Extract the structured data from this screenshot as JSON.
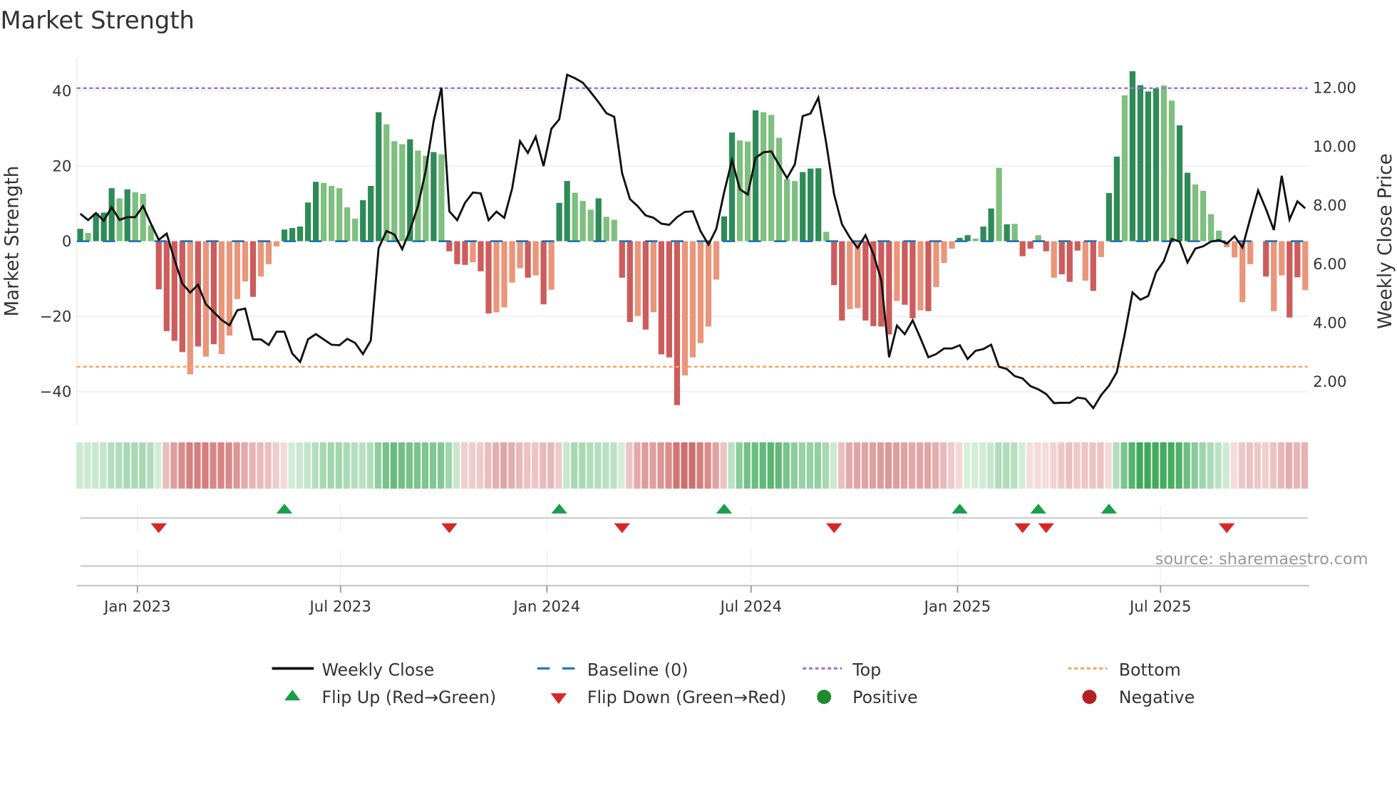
{
  "chart_data": {
    "type": "bar+line",
    "title": "Market Strength",
    "ylabel_left": "Market Strength",
    "ylabel_right": "Weekly Close Price",
    "ylim_left": [
      -49,
      49
    ],
    "ylim_right": [
      0.6,
      13.8
    ],
    "yticks_left": [
      40,
      20,
      0,
      -20,
      -40
    ],
    "ytick_labels_left": [
      "40",
      "20",
      "0",
      "−20",
      "−40"
    ],
    "yticks_right": [
      12,
      10,
      8,
      6,
      4,
      2
    ],
    "ytick_labels_right": [
      "12.00",
      "10.00",
      "8.00",
      "6.00",
      "4.00",
      "2.00"
    ],
    "x_start": "2022-11-11",
    "x_step_days": 7,
    "xticks": [
      {
        "date": "2023-01-01",
        "label": "Jan 2023"
      },
      {
        "date": "2023-07-01",
        "label": "Jul 2023"
      },
      {
        "date": "2024-01-01",
        "label": "Jan 2024"
      },
      {
        "date": "2024-07-01",
        "label": "Jul 2024"
      },
      {
        "date": "2025-01-01",
        "label": "Jan 2025"
      },
      {
        "date": "2025-07-01",
        "label": "Jul 2025"
      }
    ],
    "top_level": 40.7,
    "bottom_level": -33.4,
    "baseline": 0,
    "strength": [
      3.3,
      2.2,
      7.4,
      7.6,
      14.1,
      11.4,
      13.8,
      13.0,
      12.6,
      4.2,
      -12.8,
      -23.9,
      -26.5,
      -29.5,
      -35.4,
      -28.0,
      -30.7,
      -27.4,
      -30.0,
      -25.1,
      -15.4,
      -10.7,
      -14.8,
      -9.4,
      -6.1,
      -1.4,
      3.1,
      3.5,
      3.9,
      10.3,
      15.8,
      15.5,
      14.7,
      14.1,
      9.0,
      6.0,
      10.9,
      14.7,
      34.3,
      31.1,
      26.6,
      25.8,
      27.1,
      24.1,
      22.7,
      23.7,
      23.1,
      -2.7,
      -6.1,
      -6.3,
      -5.6,
      -8.0,
      -19.2,
      -18.9,
      -17.6,
      -11.0,
      -7.2,
      -9.7,
      -9.1,
      -16.8,
      -12.9,
      10.2,
      16.0,
      12.9,
      10.7,
      8.4,
      11.4,
      6.5,
      5.7,
      -9.7,
      -21.5,
      -19.9,
      -23.5,
      -18.9,
      -30.1,
      -30.9,
      -43.6,
      -35.7,
      -30.9,
      -27.1,
      -22.7,
      -10.2,
      6.6,
      28.9,
      26.8,
      26.5,
      34.8,
      34.3,
      33.6,
      27.5,
      16.5,
      16.0,
      18.4,
      19.3,
      19.4,
      2.5,
      -11.7,
      -21.1,
      -18.1,
      -17.8,
      -21.1,
      -22.6,
      -22.7,
      -24.8,
      -15.9,
      -16.9,
      -20.5,
      -18.4,
      -18.6,
      -12.2,
      -5.8,
      -2.0,
      0.9,
      1.6,
      0.7,
      3.9,
      8.7,
      19.5,
      4.5,
      4.6,
      -4.0,
      -2.0,
      1.6,
      -2.7,
      -9.7,
      -8.8,
      -10.8,
      -2.5,
      -10.5,
      -13.2,
      -4.2,
      12.8,
      22.5,
      38.8,
      45.2,
      41.5,
      39.8,
      40.7,
      41.4,
      37.4,
      30.8,
      18.2,
      15.1,
      13.4,
      7.2,
      2.8,
      -1.6,
      -4.3,
      -16.2,
      -6.1,
      0,
      -9.4,
      -18.6,
      -9.1,
      -20.3,
      -9.6,
      -13.0
    ],
    "strength_shade": "dldddldlllddddldldlllldllldddddllllldddllldlldlddd lddlllldldlddllldllddldldddlllllddlldllllldddlddllddddlddldlllddlddldlddldldddldldd lddddllddllllllllddllddldld",
    "weekly_close": [
      7.71,
      7.49,
      7.73,
      7.47,
      7.93,
      7.5,
      7.59,
      7.59,
      7.97,
      7.37,
      6.82,
      7.03,
      6.14,
      5.33,
      5.02,
      5.29,
      4.63,
      4.36,
      4.09,
      3.91,
      4.42,
      4.48,
      3.43,
      3.43,
      3.24,
      3.69,
      3.69,
      2.95,
      2.66,
      3.43,
      3.61,
      3.43,
      3.25,
      3.23,
      3.45,
      3.31,
      2.93,
      3.39,
      6.54,
      7.12,
      7.0,
      6.5,
      7.15,
      7.96,
      9.17,
      10.86,
      12.0,
      7.79,
      7.49,
      8.08,
      8.43,
      8.4,
      7.49,
      7.78,
      7.57,
      8.56,
      10.18,
      9.78,
      10.33,
      9.33,
      10.6,
      10.92,
      12.44,
      12.32,
      12.17,
      11.85,
      11.51,
      11.13,
      11.01,
      9.09,
      8.21,
      7.96,
      7.65,
      7.57,
      7.37,
      7.33,
      7.59,
      7.77,
      7.79,
      7.11,
      6.66,
      7.19,
      8.44,
      9.53,
      8.54,
      8.36,
      9.61,
      9.8,
      9.83,
      9.37,
      8.92,
      9.39,
      11.03,
      11.12,
      11.66,
      10.1,
      8.36,
      7.35,
      6.9,
      6.54,
      6.98,
      6.34,
      5.45,
      2.82,
      3.9,
      3.61,
      4.08,
      3.47,
      2.82,
      2.93,
      3.12,
      3.12,
      3.23,
      2.76,
      3.04,
      3.1,
      3.25,
      2.5,
      2.42,
      2.18,
      2.1,
      1.84,
      1.73,
      1.57,
      1.26,
      1.27,
      1.27,
      1.45,
      1.41,
      1.09,
      1.53,
      1.85,
      2.31,
      3.59,
      5.03,
      4.78,
      4.91,
      5.71,
      6.1,
      6.85,
      6.76,
      6.05,
      6.52,
      6.6,
      6.76,
      6.81,
      6.69,
      6.94,
      6.56,
      7.55,
      8.5,
      7.86,
      7.15,
      9.0,
      7.51,
      8.13,
      7.89
    ],
    "flip_up_dates": [
      "2023-05-12",
      "2024-01-12",
      "2024-06-07",
      "2025-01-03",
      "2025-03-14",
      "2025-05-16"
    ],
    "flip_down_dates": [
      "2023-01-20",
      "2023-10-06",
      "2024-03-08",
      "2024-09-13",
      "2025-02-28",
      "2025-03-21",
      "2025-08-29"
    ],
    "legend": {
      "placement": "bottom",
      "items": [
        "Weekly Close",
        "Baseline (0)",
        "Top",
        "Bottom",
        "Flip Up (Red→Green)",
        "Flip Down (Green→Red)",
        "Positive",
        "Negative"
      ]
    },
    "annotation": "source: sharemaestro.com",
    "grid": true
  },
  "colors": {
    "green_dark": "#2e8b57",
    "green_light": "#7fbf7f",
    "red_dark": "#cd5c5c",
    "red_light": "#e9967a",
    "line": "#111111",
    "baseline": "#1f77b4",
    "top": "#a070e0",
    "bottom": "#f4a460",
    "flip_up": "#1a9e49",
    "flip_down": "#d62728",
    "positive": "#1e8a2e",
    "negative": "#b22222"
  }
}
